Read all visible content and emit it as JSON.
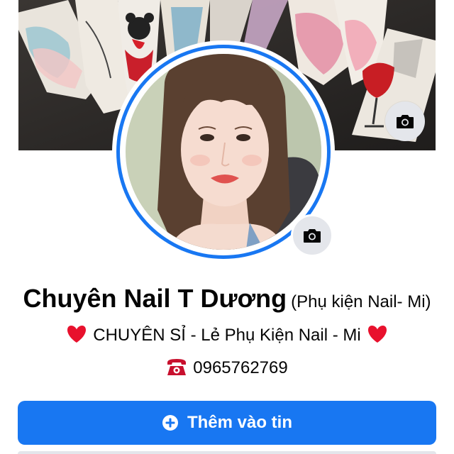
{
  "profile": {
    "name": "Chuyên Nail T Dương",
    "name_suffix": "(Phụ kiện Nail- Mi)",
    "bio": "CHUYÊN SỈ - Lẻ Phụ Kiện Nail - Mi",
    "phone": "0965762769"
  },
  "actions": {
    "add_to_story_label": "Thêm vào tin"
  },
  "icons": {
    "cover_camera": "camera-icon",
    "avatar_camera": "camera-icon",
    "bio_left": "red-heart-icon",
    "bio_right": "red-heart-icon",
    "phone": "telephone-icon",
    "add_story": "plus-circle-icon"
  },
  "colors": {
    "accent": "#1877f2",
    "heart": "#e8112d",
    "text": "#050505",
    "icon_bg": "#e4e6eb"
  }
}
